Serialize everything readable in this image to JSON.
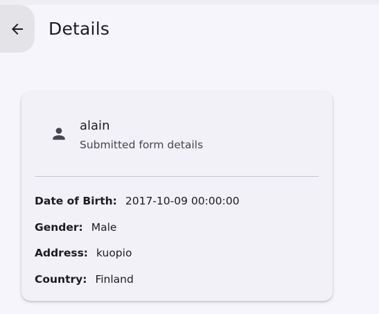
{
  "header": {
    "title": "Details",
    "back_icon": "arrow-back-icon"
  },
  "card": {
    "user_icon": "person-icon",
    "name": "alain",
    "subtitle": "Submitted form details",
    "fields": [
      {
        "label": "Date of Birth:",
        "value": "2017-10-09 00:00:00"
      },
      {
        "label": "Gender:",
        "value": "Male"
      },
      {
        "label": "Address:",
        "value": "kuopio"
      },
      {
        "label": "Country:",
        "value": "Finland"
      }
    ]
  },
  "colors": {
    "background": "#f6f5fb",
    "card": "#f1f1f7",
    "back_button": "#e3e3e8"
  }
}
